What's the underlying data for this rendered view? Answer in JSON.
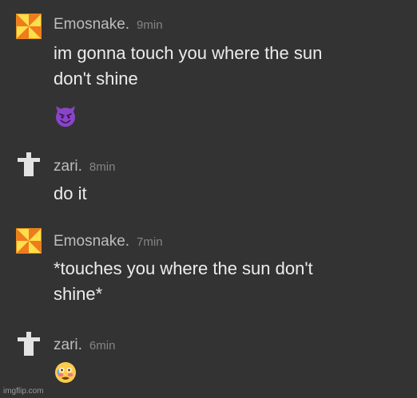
{
  "messages": [
    {
      "user": "Emosnake.",
      "time": "9min",
      "avatar_icon": "pinwheel-icon",
      "lines": [
        "im gonna touch you where the sun",
        "don't shine"
      ],
      "emoji": "smiling-devil-emoji"
    },
    {
      "user": "zari.",
      "time": "8min",
      "avatar_icon": "cross-icon",
      "lines": [
        "do it"
      ]
    },
    {
      "user": "Emosnake.",
      "time": "7min",
      "avatar_icon": "pinwheel-icon",
      "lines": [
        "*touches you where the sun don't",
        "shine*"
      ]
    },
    {
      "user": "zari.",
      "time": "6min",
      "avatar_icon": "cross-icon",
      "emoji": "flushed-tear-face-emoji"
    }
  ],
  "watermark": "imgflip.com",
  "colors": {
    "background": "#333333",
    "username": "#bdbdbd",
    "timestamp": "#858585",
    "text": "#ececec",
    "pinwheel_yellow": "#f6c12d",
    "pinwheel_orange": "#f07a1e",
    "cross": "#e3e3e3"
  }
}
